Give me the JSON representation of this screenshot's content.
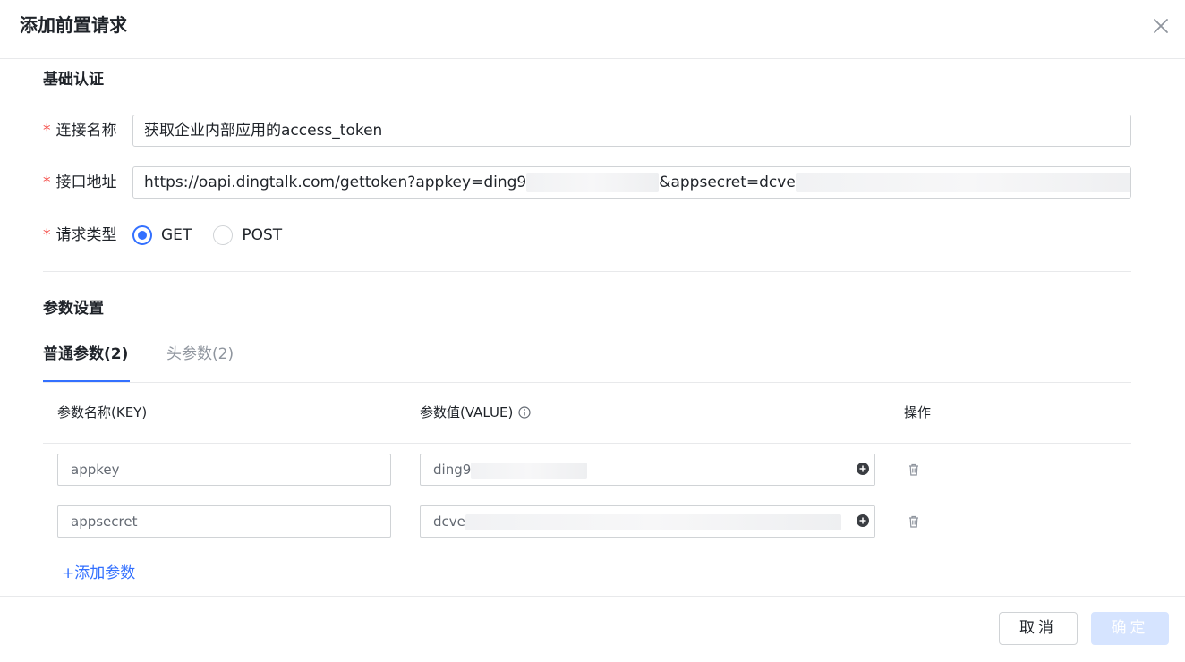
{
  "dialog": {
    "title": "添加前置请求"
  },
  "basic": {
    "section_title": "基础认证",
    "name_label": "连接名称",
    "name_value": "获取企业内部应用的access_token",
    "url_label": "接口地址",
    "url_part1": "https://oapi.dingtalk.com/gettoken?appkey=ding9",
    "url_part2": "&appsecret=dcve",
    "method_label": "请求类型",
    "method_options": [
      "GET",
      "POST"
    ],
    "method_selected": "GET"
  },
  "params": {
    "section_title": "参数设置",
    "tabs": [
      {
        "label": "普通参数(2)",
        "active": true
      },
      {
        "label": "头参数(2)",
        "active": false
      }
    ],
    "columns": {
      "key": "参数名称(KEY)",
      "value": "参数值(VALUE)",
      "action": "操作"
    },
    "rows": [
      {
        "key": "appkey",
        "value": "ding9"
      },
      {
        "key": "appsecret",
        "value": "dcve"
      }
    ],
    "add_label": "+添加参数"
  },
  "footer": {
    "cancel": "取消",
    "ok": "确定"
  },
  "colors": {
    "primary": "#3370ff",
    "primary_disabled": "#d6e4ff",
    "required": "#f54a45",
    "border": "#d0d3d6",
    "divider": "#e8e9eb"
  }
}
